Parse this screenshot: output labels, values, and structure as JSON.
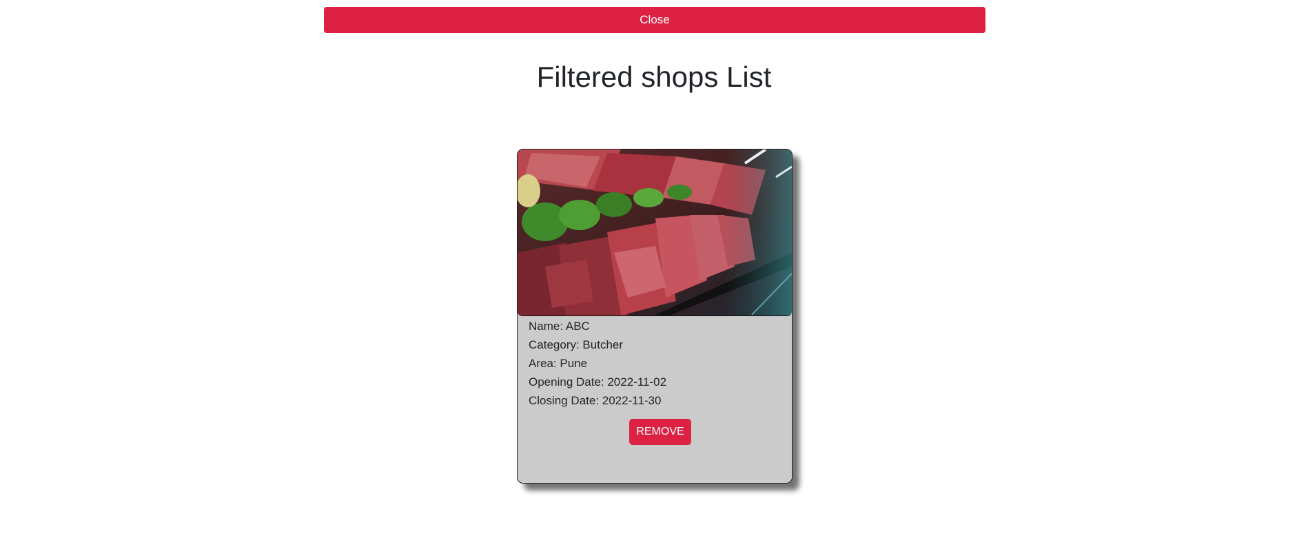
{
  "header": {
    "close_label": "Close"
  },
  "page": {
    "title": "Filtered shops List"
  },
  "shops": [
    {
      "image": "meat-display-photo",
      "name_line": "Name: ABC",
      "category_line": "Category: Butcher",
      "area_line": "Area: Pune",
      "opening_line": "Opening Date: 2022-11-02",
      "closing_line": "Closing Date: 2022-11-30",
      "remove_label": "REMOVE"
    }
  ],
  "colors": {
    "accent": "#dc2143",
    "card_background": "#cbcbcb",
    "button_text": "#ffffff",
    "text": "#212529"
  }
}
